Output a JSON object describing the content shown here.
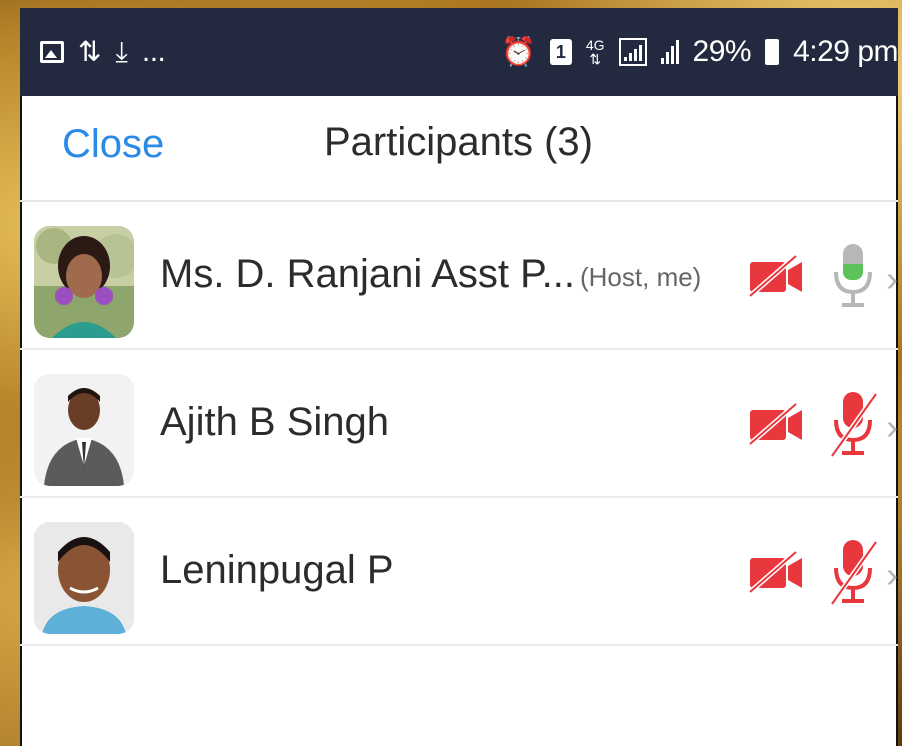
{
  "statusbar": {
    "icons_left": [
      "image-icon",
      "data-sync-icon",
      "download-icon"
    ],
    "more": "...",
    "network": "4G",
    "battery": "29%",
    "time": "4:29 pm"
  },
  "header": {
    "close_label": "Close",
    "title": "Participants (3)"
  },
  "participants": [
    {
      "name": "Ms. D. Ranjani Asst P...",
      "role": "(Host, me)",
      "video": "off",
      "audio": "on"
    },
    {
      "name": "Ajith B Singh",
      "role": "",
      "video": "off",
      "audio": "muted"
    },
    {
      "name": "Leninpugal P",
      "role": "",
      "video": "off",
      "audio": "muted"
    }
  ],
  "colors": {
    "accent": "#2a8ae8",
    "muted_red": "#e8383d",
    "mic_active_green": "#5cc35b",
    "statusbar_bg": "#232a3f"
  }
}
